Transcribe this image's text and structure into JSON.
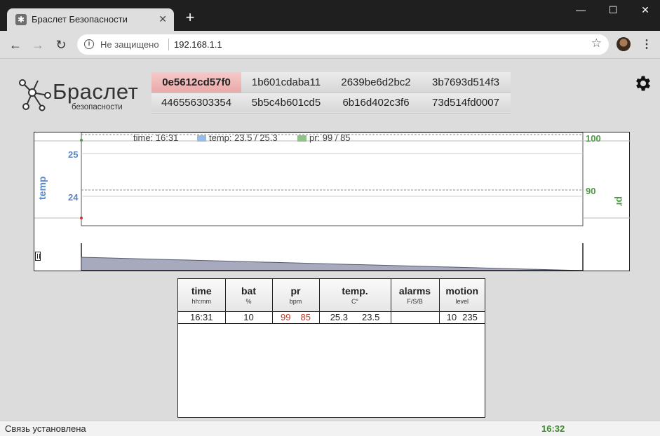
{
  "browser": {
    "tab_title": "Браслет Безопасности",
    "tab_close": "✕",
    "new_tab": "+",
    "security_text": "Не защищено",
    "url": "192.168.1.1",
    "window_controls": [
      "—",
      "☐",
      "✕"
    ],
    "nav": {
      "back": "←",
      "forward": "→",
      "reload": "↻",
      "star": "☆",
      "menu": "⋮",
      "info": "i"
    }
  },
  "logo": {
    "title": "Браслет",
    "subtitle": "безопасности"
  },
  "devices": {
    "row1": [
      "0e5612cd57f0",
      "1b601cdaba11",
      "2639be6d2bc2",
      "3b7693d514f3"
    ],
    "row2": [
      "446556303354",
      "5b5c4b601cd5",
      "6b16d402c3f6",
      "73d514fd0007"
    ],
    "active": "0e5612cd57f0"
  },
  "chart": {
    "legend_time": "time: 16:31",
    "legend_temp": "temp: 23.5 / 25.3",
    "legend_pr": "pr: 99 / 85",
    "left_axis_label": "temp",
    "right_axis_label": "pr",
    "left_ticks": [
      "25",
      "24"
    ],
    "right_ticks": [
      "100",
      "90"
    ],
    "colors": {
      "temp": "#5b86c7",
      "pr": "#4e9a45",
      "temp_legend": "#9bb9e6",
      "pr_legend": "#8fc28a"
    }
  },
  "chart_data": {
    "type": "line",
    "x": [
      "16:31"
    ],
    "series": [
      {
        "name": "temp",
        "values": [
          23.5,
          25.3
        ]
      },
      {
        "name": "pr",
        "values": [
          99,
          85
        ]
      }
    ],
    "left_axis": {
      "ticks": [
        25,
        24
      ]
    },
    "right_axis": {
      "ticks": [
        100,
        90
      ]
    }
  },
  "table": {
    "headers": [
      {
        "title": "time",
        "sub": "hh:mm"
      },
      {
        "title": "bat",
        "sub": "%"
      },
      {
        "title": "pr",
        "sub": "bpm"
      },
      {
        "title": "temp.",
        "sub": "C°"
      },
      {
        "title": "alarms",
        "sub": "F/S/B"
      },
      {
        "title": "motion",
        "sub": "level"
      }
    ],
    "rows": [
      {
        "time": "16:31",
        "bat": "10",
        "pr1": "99",
        "pr2": "85",
        "temp1": "25.3",
        "temp2": "23.5",
        "alarms": "",
        "motion1": "10",
        "motion2": "235"
      }
    ]
  },
  "status": {
    "text": "Связь установлена",
    "time": "16:32"
  }
}
